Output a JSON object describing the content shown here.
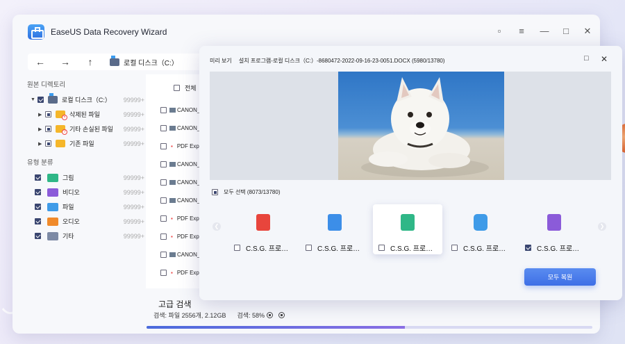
{
  "app": {
    "title": "EaseUS Data Recovery Wizard"
  },
  "nav": {
    "path": "로컬 디스크（C:）"
  },
  "sidebar": {
    "section_tree": "원본 디렉토리",
    "tree": [
      {
        "label": "로컬 디스크（C:）",
        "count": "99999+"
      },
      {
        "label": "삭제된 파일",
        "count": "99999+"
      },
      {
        "label": "기타 손실된 파일",
        "count": "99999+"
      },
      {
        "label": "기존 파일",
        "count": "99999+"
      }
    ],
    "section_type": "유형 분류",
    "types": [
      {
        "label": "그림",
        "count": "99999+",
        "color": "#2fb787"
      },
      {
        "label": "비디오",
        "count": "99999+",
        "color": "#8b5bd9"
      },
      {
        "label": "파일",
        "count": "99999+",
        "color": "#3f9be8"
      },
      {
        "label": "오디오",
        "count": "99999+",
        "color": "#f08a2b"
      },
      {
        "label": "기타",
        "count": "99999+",
        "color": "#7d8aa5"
      }
    ]
  },
  "filelist": {
    "header": "전체",
    "rows": [
      {
        "kind": "img",
        "name": "CANON_"
      },
      {
        "kind": "img",
        "name": "CANON_"
      },
      {
        "kind": "pdf",
        "name": "PDF Exp"
      },
      {
        "kind": "img",
        "name": "CANON_"
      },
      {
        "kind": "img",
        "name": "CANON_"
      },
      {
        "kind": "img",
        "name": "CANON_"
      },
      {
        "kind": "pdf",
        "name": "PDF Exp"
      },
      {
        "kind": "pdf",
        "name": "PDF Exp"
      },
      {
        "kind": "img",
        "name": "CANON_"
      },
      {
        "kind": "pdf",
        "name": "PDF Exp"
      }
    ]
  },
  "scan": {
    "title": "고급 검색",
    "status": "검색: 파일 2556개, 2.12GB",
    "progress_label": "검색: 58%",
    "progress": 0.58
  },
  "preview": {
    "label": "미리 보기",
    "location": "설치 프로그램-로컬 디스크（C:）-8680472-2022-09-16-23-0051.DOCX (5980/13780)",
    "select_all": "모두 선택 (8073/13780)",
    "cards": [
      {
        "label": "C.S.G. 프로…",
        "icon": "mp3-file-icon",
        "color": "#e8453c",
        "checked": false
      },
      {
        "label": "C.S.G. 프로…",
        "icon": "word-file-icon",
        "color": "#3c8ee8",
        "checked": false
      },
      {
        "label": "C.S.G. 프로…",
        "icon": "image-file-icon",
        "color": "#2fb787",
        "checked": false,
        "selected": true
      },
      {
        "label": "C.S.G. 프로…",
        "icon": "camera-icon",
        "color": "#3f9be8",
        "checked": false
      },
      {
        "label": "C.S.G. 프로…",
        "icon": "mov-file-icon",
        "color": "#8b5bd9",
        "checked": true
      }
    ],
    "recover_button": "모두 복원"
  }
}
